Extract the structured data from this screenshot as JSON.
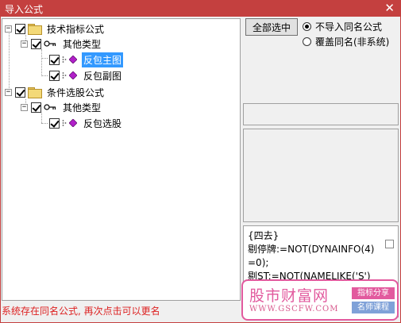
{
  "window": {
    "title": "导入公式",
    "close_glyph": "✕"
  },
  "tree": {
    "nodes": [
      {
        "label": "技术指标公式",
        "checked": true,
        "expanded": true
      },
      {
        "label": "其他类型",
        "checked": true,
        "expanded": true
      },
      {
        "label": "反包主图",
        "checked": true,
        "selected": true
      },
      {
        "label": "反包副图",
        "checked": true,
        "selected": false
      },
      {
        "label": "条件选股公式",
        "checked": true,
        "expanded": true
      },
      {
        "label": "其他类型",
        "checked": true,
        "expanded": true
      },
      {
        "label": "反包选股",
        "checked": true,
        "selected": false
      }
    ],
    "collapse_glyph": "−"
  },
  "options": {
    "select_all_button": "全部选中",
    "radio_skip": "不导入同名公式",
    "radio_overwrite": "覆盖同名(非系统)",
    "selected_radio": "skip"
  },
  "formula_preview": {
    "text": "{四去}\n剔停牌:=NOT(DYNAINFO(4)=0);\n剔ST:=NOT(NAMELIKE('S')"
  },
  "status": {
    "message": "系统存在同名公式, 再次点击可以更名"
  },
  "watermark": {
    "brand": "股市财富网",
    "url": "WWW.GSCFW.COM",
    "tag1": "指标分享",
    "tag2": "名师课程"
  },
  "colors": {
    "title_bar": "#c4403f",
    "selection": "#3399ff",
    "status_text": "#dd2222",
    "watermark": "#e25a9e"
  },
  "icons": {
    "folder": "folder-icon",
    "key": "key-icon",
    "formula": "gem-icon"
  }
}
